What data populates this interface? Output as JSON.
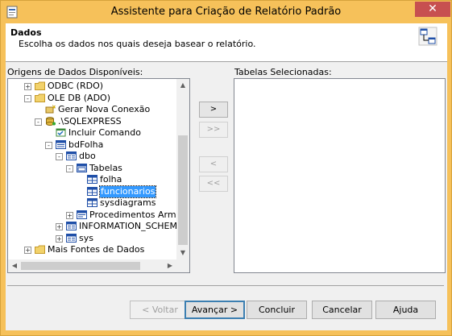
{
  "window": {
    "title": "Assistente para Criação de Relatório Padrão",
    "close": "✕"
  },
  "header": {
    "title": "Dados",
    "description": "Escolha os dados nos quais deseja basear o relatório."
  },
  "left_panel": {
    "label": "Origens de Dados Disponíveis:"
  },
  "right_panel": {
    "label": "Tabelas Selecionadas:"
  },
  "tree": [
    {
      "label": "ODBC (RDO)",
      "icon": "folder-icon",
      "expander": "+",
      "selected": false
    },
    {
      "label": "OLE DB (ADO)",
      "icon": "folder-icon",
      "expander": "-",
      "selected": false
    },
    {
      "label": "Gerar Nova Conexão",
      "icon": "new-connection-icon",
      "expander": "",
      "selected": false
    },
    {
      "label": ".\\SQLEXPRESS",
      "icon": "server-icon",
      "expander": "-",
      "selected": false
    },
    {
      "label": "Incluir Comando",
      "icon": "command-icon",
      "expander": "",
      "selected": false
    },
    {
      "label": "bdFolha",
      "icon": "database-icon",
      "expander": "-",
      "selected": false
    },
    {
      "label": "dbo",
      "icon": "schema-icon",
      "expander": "-",
      "selected": false
    },
    {
      "label": "Tabelas",
      "icon": "tables-folder-icon",
      "expander": "-",
      "selected": false
    },
    {
      "label": "folha",
      "icon": "table-icon",
      "expander": "",
      "selected": false
    },
    {
      "label": "funcionarios",
      "icon": "table-icon",
      "expander": "",
      "selected": true
    },
    {
      "label": "sysdiagrams",
      "icon": "table-icon",
      "expander": "",
      "selected": false
    },
    {
      "label": "Procedimentos Armazen",
      "icon": "procedures-icon",
      "expander": "+",
      "selected": false
    },
    {
      "label": "INFORMATION_SCHEMA",
      "icon": "schema-icon",
      "expander": "+",
      "selected": false
    },
    {
      "label": "sys",
      "icon": "schema-icon",
      "expander": "+",
      "selected": false
    },
    {
      "label": "Mais Fontes de Dados",
      "icon": "folder-icon",
      "expander": "+",
      "selected": false
    }
  ],
  "transfer_buttons": {
    "add": ">",
    "add_all": ">>",
    "remove": "<",
    "remove_all": "<<"
  },
  "footer": {
    "back": "< Voltar",
    "next": "Avançar >",
    "finish": "Concluir",
    "cancel": "Cancelar",
    "help": "Ajuda"
  }
}
